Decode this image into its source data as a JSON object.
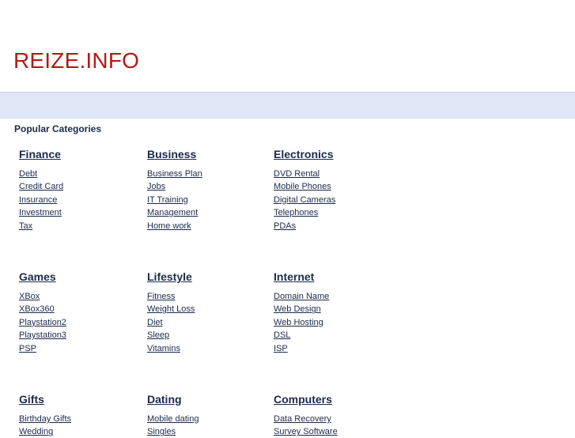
{
  "site": {
    "title": "REIZE.INFO"
  },
  "popular": {
    "title": "Popular Categories"
  },
  "categories": [
    {
      "name": "Finance",
      "links": [
        "Debt",
        "Credit Card",
        "Insurance",
        "Investment",
        "Tax"
      ]
    },
    {
      "name": "Business",
      "links": [
        "Business Plan",
        "Jobs",
        "IT Training",
        "Management",
        "Home work"
      ]
    },
    {
      "name": "Electronics",
      "links": [
        "DVD Rental",
        "Mobile Phones",
        "Digital Cameras",
        "Telephones",
        "PDAs"
      ]
    },
    {
      "name": "Games",
      "links": [
        "XBox",
        "XBox360",
        "Playstation2",
        "Playstation3",
        "PSP"
      ]
    },
    {
      "name": "Lifestyle",
      "links": [
        "Fitness",
        "Weight Loss",
        "Diet",
        "Sleep",
        "Vitamins"
      ]
    },
    {
      "name": "Internet",
      "links": [
        "Domain Name",
        "Web Design",
        "Web Hosting",
        "DSL",
        "ISP"
      ]
    },
    {
      "name": "Gifts",
      "links": [
        "Birthday Gifts",
        "Wedding"
      ]
    },
    {
      "name": "Dating",
      "links": [
        "Mobile dating",
        "Singles"
      ]
    },
    {
      "name": "Computers",
      "links": [
        "Data Recovery",
        "Survey Software"
      ]
    }
  ],
  "colors": {
    "title": "#b41a1a",
    "band": "#dfe6f6",
    "link": "#1b2a4a"
  }
}
